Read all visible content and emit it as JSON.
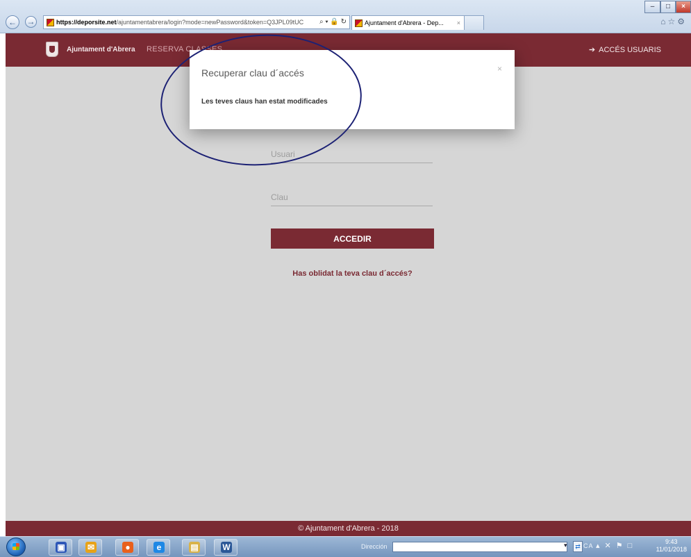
{
  "browser": {
    "url_host": "https://deporsite.net",
    "url_path": "/ajuntamentabrera/login?mode=newPassword&token=Q3JPL09tUC",
    "address_tools": "⌕ ▾ 🔒 ↻",
    "tab_title": "Ajuntament d'Abrera - Dep...",
    "tab_close": "×",
    "back_glyph": "←",
    "forward_glyph": "→",
    "window_min": "–",
    "window_max": "□",
    "window_close": "×",
    "toolbar_icons": "⌂☆⚙"
  },
  "header": {
    "brand": "Ajuntament d'Abrera",
    "nav_reserva": "RESERVA CLASSES",
    "login_icon": "➔",
    "login_label": "ACCÉS USUARIS"
  },
  "login": {
    "user_placeholder": "Usuari",
    "password_placeholder": "Clau",
    "submit_label": "ACCEDIR",
    "forgot_link": "Has oblidat la teva clau d´accés?"
  },
  "modal": {
    "title": "Recuperar clau d´accés",
    "message": "Les teves claus han estat modificades",
    "close_glyph": "×"
  },
  "footer": {
    "copyright": "© Ajuntament d'Abrera - 2018"
  },
  "taskbar": {
    "apps": [
      {
        "name": "network-app",
        "glyph": "▣",
        "color": "#2f58b8"
      },
      {
        "name": "outlook-app",
        "glyph": "✉",
        "color": "#e8a317"
      },
      {
        "name": "firefox-app",
        "glyph": "●",
        "color": "#e8601c"
      },
      {
        "name": "ie-app",
        "glyph": "e",
        "color": "#1e88e5"
      },
      {
        "name": "explorer-app",
        "glyph": "▤",
        "color": "#d9b34a"
      },
      {
        "name": "word-app",
        "glyph": "W",
        "color": "#2b5797"
      }
    ],
    "address_label": "Dirección",
    "address_dropdown": "▾",
    "go_glyph": "⇄",
    "language": "CA",
    "tray_icons": "▴✕⚑□",
    "time": "9:43",
    "date": "11/01/2018"
  },
  "colors": {
    "brand": "#7a2a33",
    "annotation": "#1c2174"
  }
}
